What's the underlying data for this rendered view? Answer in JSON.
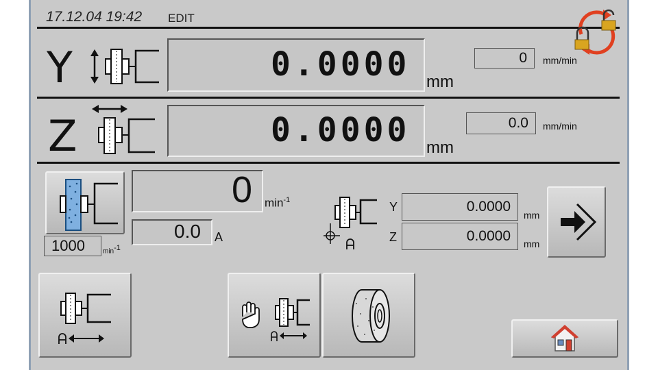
{
  "header": {
    "datetime": "17.12.04 19:42",
    "mode": "EDIT"
  },
  "axis_y": {
    "letter": "Y",
    "value": "0.0000",
    "unit": "mm",
    "feed_value": "0",
    "feed_unit": "mm/min"
  },
  "axis_z": {
    "letter": "Z",
    "value": "0.0000",
    "unit": "mm",
    "feed_value": "0.0",
    "feed_unit": "mm/min"
  },
  "spindle": {
    "speed_value": "0",
    "speed_unit": "min",
    "speed_unit_sup": "-1",
    "current_value": "0.0",
    "current_unit": "A",
    "set_speed": "1000",
    "set_speed_unit": "min",
    "set_speed_unit_sup": "-1"
  },
  "reference": {
    "y_label": "Y",
    "y_value": "0.0000",
    "y_unit": "mm",
    "z_label": "Z",
    "z_value": "0.0000",
    "z_unit": "mm"
  },
  "icons": [
    "lock-toggle-icon",
    "axis-y-spindle-icon",
    "axis-z-spindle-icon",
    "spindle-button-icon",
    "reference-icon",
    "enter-arrow-icon",
    "reference-travel-icon",
    "manual-travel-icon",
    "grinding-wheel-icon",
    "home-icon"
  ],
  "colors": {
    "screen_bg": "#c9c9c9",
    "frame": "#8fa0b4",
    "wheel_blue": "#7fb0e0",
    "lock_gold": "#d9a520",
    "arrow_red": "#e04020"
  }
}
